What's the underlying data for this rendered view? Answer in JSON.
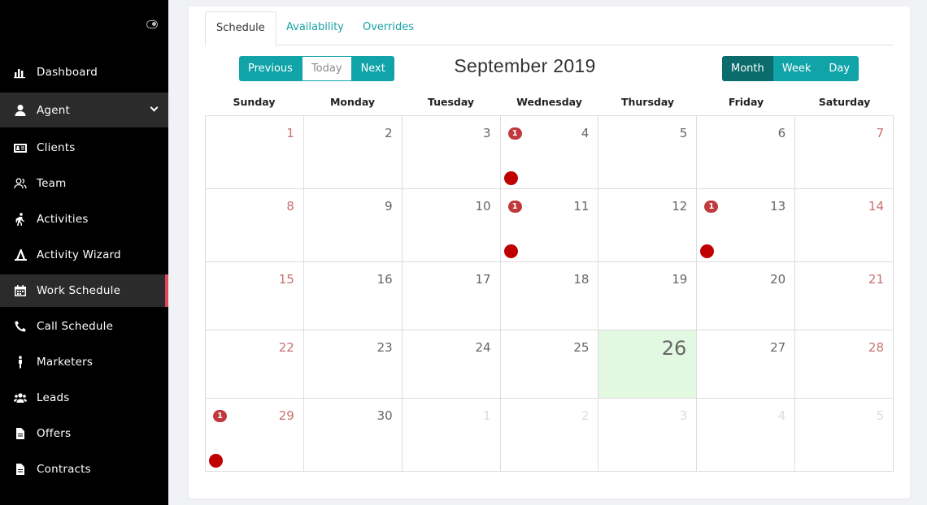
{
  "sidebar": {
    "items": [
      {
        "label": "Dashboard",
        "icon": "bar-chart-icon"
      },
      {
        "label": "Agent",
        "icon": "user-icon"
      },
      {
        "label": "Clients",
        "icon": "id-card-icon"
      },
      {
        "label": "Team",
        "icon": "team-icon"
      },
      {
        "label": "Activities",
        "icon": "walking-icon"
      },
      {
        "label": "Activity Wizard",
        "icon": "wizard-icon"
      },
      {
        "label": "Work Schedule",
        "icon": "calendar-icon"
      },
      {
        "label": "Call Schedule",
        "icon": "phone-icon"
      },
      {
        "label": "Marketers",
        "icon": "person-icon"
      },
      {
        "label": "Leads",
        "icon": "users-icon"
      },
      {
        "label": "Offers",
        "icon": "file-icon"
      },
      {
        "label": "Contracts",
        "icon": "document-icon"
      }
    ]
  },
  "tabs": [
    "Schedule",
    "Availability",
    "Overrides"
  ],
  "nav_buttons": {
    "previous": "Previous",
    "today": "Today",
    "next": "Next"
  },
  "view_buttons": {
    "month": "Month",
    "week": "Week",
    "day": "Day"
  },
  "calendar": {
    "title": "September 2019",
    "days_of_week": [
      "Sunday",
      "Monday",
      "Tuesday",
      "Wednesday",
      "Thursday",
      "Friday",
      "Saturday"
    ],
    "weeks": [
      [
        "1",
        "2",
        "3",
        "4",
        "5",
        "6",
        "7"
      ],
      [
        "8",
        "9",
        "10",
        "11",
        "12",
        "13",
        "14"
      ],
      [
        "15",
        "16",
        "17",
        "18",
        "19",
        "20",
        "21"
      ],
      [
        "22",
        "23",
        "24",
        "25",
        "26",
        "27",
        "28"
      ],
      [
        "29",
        "30",
        "1",
        "2",
        "3",
        "4",
        "5"
      ]
    ],
    "event_badge": "1",
    "accent_color": "#10a4a8",
    "event_color": "#c0393d",
    "today_bg": "#e3f8e0"
  }
}
